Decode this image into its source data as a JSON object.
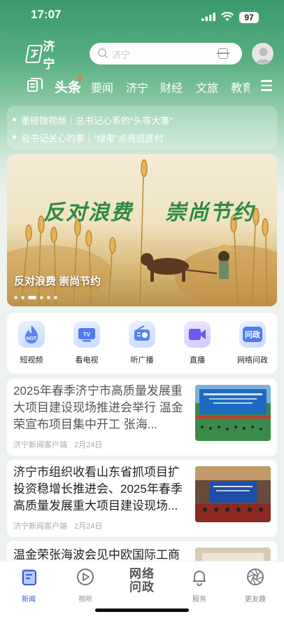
{
  "status": {
    "time": "17:07",
    "battery": "97"
  },
  "header": {
    "logo_text": "济宁",
    "search_placeholder": "济宁"
  },
  "tabs": [
    {
      "label": "头条",
      "active": true
    },
    {
      "label": "要闻"
    },
    {
      "label": "济宁"
    },
    {
      "label": "财经"
    },
    {
      "label": "文旅"
    },
    {
      "label": "教育"
    }
  ],
  "ticker": [
    "重磅微视频｜总书记心系的“头等大事”",
    "总书记关心的事｜“绿电”点亮班彦村"
  ],
  "banner": {
    "headline_left": "反对浪费",
    "headline_right": "崇尚节约",
    "caption": "反对浪费 崇尚节约"
  },
  "quick": [
    {
      "label": "短视频",
      "icon": "hot-flame-icon"
    },
    {
      "label": "看电视",
      "icon": "tv-icon"
    },
    {
      "label": "听广播",
      "icon": "radio-icon"
    },
    {
      "label": "直播",
      "icon": "live-camera-icon"
    },
    {
      "label": "网络问政",
      "icon": "wenzheng-icon",
      "icon_text": "问政"
    }
  ],
  "quick_hot_text": "HOT",
  "quick_tv_text": "TV",
  "news": [
    {
      "title": "2025年春季济宁市高质量发展重大项目建设现场推进会举行  温金荣宣布项目集中开工    张海...",
      "source": "济宁新闻客户端",
      "date": "2月24日"
    },
    {
      "title": "济宁市组织收看山东省抓项目扩投资稳增长推进会、2025年春季高质量发展重大项目建设现场...",
      "source": "济宁新闻客户端",
      "date": "2月24日"
    },
    {
      "title": "温金荣张海波会见中欧国际工商"
    }
  ],
  "bottom_nav": [
    {
      "label": "新闻",
      "icon": "news-icon",
      "active": true
    },
    {
      "label": "视听",
      "icon": "play-icon"
    },
    {
      "label": "网络问政",
      "icon": "wenzheng-icon",
      "center_top": "网络",
      "center_bottom": "问政"
    },
    {
      "label": "服务",
      "icon": "bell-icon"
    },
    {
      "label": "更友趣",
      "icon": "aperture-icon"
    }
  ],
  "colors": {
    "accent_green": "#2d8a45",
    "nav_active": "#3d5ad9",
    "quick_blue": "#3f6ee8"
  }
}
